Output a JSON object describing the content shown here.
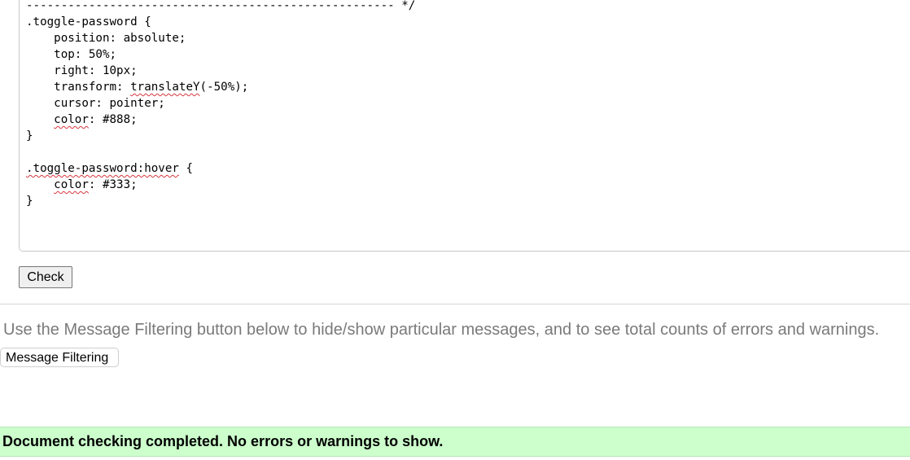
{
  "editor": {
    "lines": [
      "----------------------------------------------------- */",
      ".toggle-password {",
      "    position: absolute;",
      "    top: 50%;",
      "    right: 10px;",
      "    transform: ",
      "    cursor: pointer;",
      "    ",
      "}",
      "",
      "",
      "    ",
      "}"
    ],
    "line6_fn": "translateY",
    "line6_rest": "(-50%);",
    "line7_prop": "color",
    "line7_rest": ": #888;",
    "line10_selector": ".toggle-password:hover",
    "line10_rest": " {",
    "line11_prop": "color",
    "line11_rest": ": #333;"
  },
  "check_button": {
    "label": "Check"
  },
  "filtering": {
    "hint": "Use the Message Filtering button below to hide/show particular messages, and to see total counts of errors and warnings.",
    "button_label": "Message Filtering"
  },
  "status": {
    "message": "Document checking completed. No errors or warnings to show.",
    "background_color": "#ccffcc"
  }
}
